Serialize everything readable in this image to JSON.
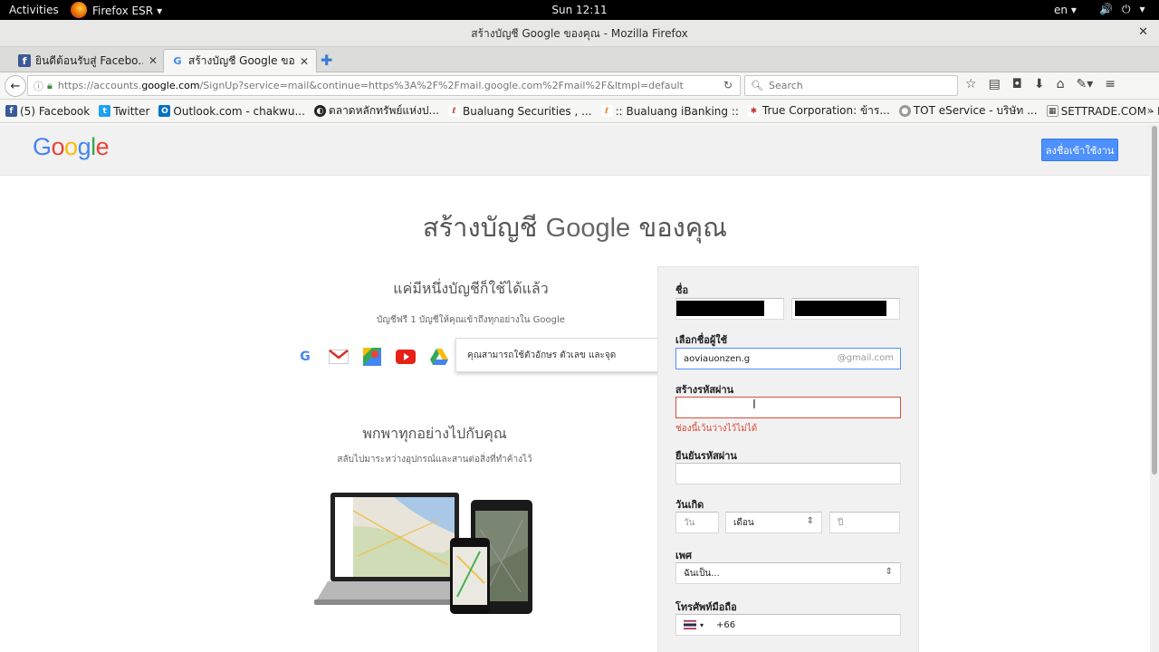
{
  "system_bar": {
    "activities": "Activities",
    "app": "Firefox ESR",
    "clock": "Sun 12:11",
    "lang": "en"
  },
  "window": {
    "title": "สร้างบัญชี Google ของคุณ - Mozilla Firefox"
  },
  "tabs": [
    {
      "label": "ยินดีต้อนรับสู่ Facebo...",
      "icon": "facebook-icon",
      "active": false
    },
    {
      "label": "สร้างบัญชี Google ขอ...",
      "icon": "google-icon",
      "active": true
    }
  ],
  "navbar": {
    "url_prefix": "https://accounts.",
    "url_host": "google.com",
    "url_rest": "/SignUp?service=mail&continue=https%3A%2F%2Fmail.google.com%2Fmail%2F&ltmpl=default",
    "search_placeholder": "Search"
  },
  "bookmarks": [
    {
      "label": "(5) Facebook",
      "icon": "facebook-icon",
      "color": "#3b5998"
    },
    {
      "label": "Twitter",
      "icon": "twitter-icon",
      "color": "#1da1f2"
    },
    {
      "label": "Outlook.com - chakwu...",
      "icon": "outlook-icon",
      "color": "#0072c6"
    },
    {
      "label": "ตลาดหลักทรัพย์แห่งป...",
      "icon": "set-icon",
      "color": "#222222"
    },
    {
      "label": "Bualuang Securities , ...",
      "icon": "bualuang-icon",
      "color": "#c0392b"
    },
    {
      "label": ":: Bualuang iBanking ::",
      "icon": "ibanking-icon",
      "color": "#e67e22"
    },
    {
      "label": "True Corporation: ข้าร...",
      "icon": "true-icon",
      "color": "#c0392b"
    },
    {
      "label": "TOT eService - บริษัท ...",
      "icon": "tot-icon",
      "color": "#777777"
    },
    {
      "label": "SETTRADE.COM - Lea...",
      "icon": "settrade-icon",
      "color": "#333333"
    }
  ],
  "page": {
    "logo": "Google",
    "signin_button": "ลงชื่อเข้าใช้งาน",
    "title_before": "สร้างบัญชี ",
    "title_google": "Google",
    "title_after": " ของคุณ",
    "left": {
      "heading1": "แค่มีหนึ่งบัญชีก็ใช้ได้แล้ว",
      "sub1": "บัญชีฟรี 1 บัญชีให้คุณเข้าถึงทุกอย่างใน Google",
      "heading2": "พกพาทุกอย่างไปกับคุณ",
      "sub2": "สลับไปมาระหว่างอุปกรณ์และสานต่อสิ่งที่ทำค้างไว้"
    },
    "tooltip": "คุณสามารถใช้ตัวอักษร ตัวเลข และจุด",
    "form": {
      "name_label": "ชื่อ",
      "username_label": "เลือกชื่อผู้ใช้",
      "username_value": "aoviauonzen.g",
      "username_suffix": "@gmail.com",
      "password_label": "สร้างรหัสผ่าน",
      "password_error": "ช่องนี้เว้นว่างไว้ไม่ได้",
      "confirm_label": "ยืนยันรหัสผ่าน",
      "birthday_label": "วันเกิด",
      "day_placeholder": "วัน",
      "month_value": "เดือน",
      "year_placeholder": "ปี",
      "gender_label": "เพศ",
      "gender_value": "ฉันเป็น...",
      "phone_label": "โทรศัพท์มือถือ",
      "phone_prefix": "+66"
    }
  },
  "colors": {
    "accent_blue": "#4d90fe",
    "error_red": "#dd4b39"
  }
}
